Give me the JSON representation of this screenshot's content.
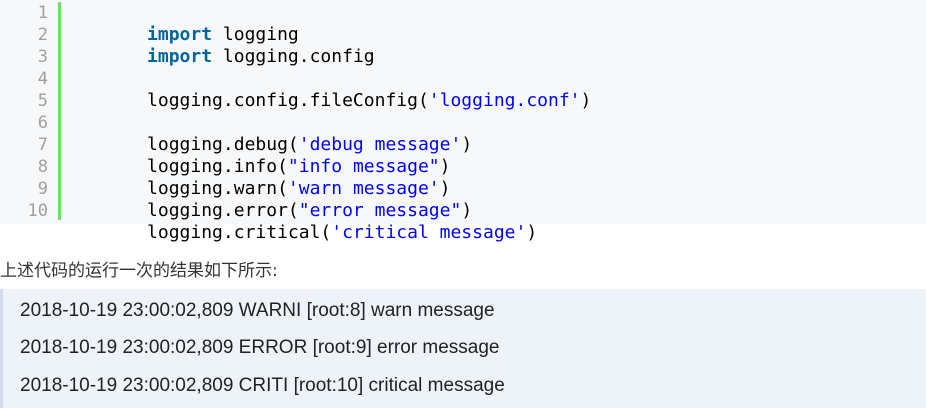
{
  "code": {
    "line_numbers": [
      "1",
      "2",
      "3",
      "4",
      "5",
      "6",
      "7",
      "8",
      "9",
      "10"
    ],
    "lines": [
      [
        {
          "t": "kw",
          "v": "import"
        },
        {
          "t": "plain",
          "v": " logging"
        }
      ],
      [
        {
          "t": "kw",
          "v": "import"
        },
        {
          "t": "plain",
          "v": " logging.config"
        }
      ],
      [],
      [
        {
          "t": "plain",
          "v": "logging.config.fileConfig("
        },
        {
          "t": "str",
          "v": "'logging.conf'"
        },
        {
          "t": "plain",
          "v": ")"
        }
      ],
      [],
      [
        {
          "t": "plain",
          "v": "logging.debug("
        },
        {
          "t": "str",
          "v": "'debug message'"
        },
        {
          "t": "plain",
          "v": ")"
        }
      ],
      [
        {
          "t": "plain",
          "v": "logging.info("
        },
        {
          "t": "str",
          "v": "\"info message\""
        },
        {
          "t": "plain",
          "v": ")"
        }
      ],
      [
        {
          "t": "plain",
          "v": "logging.warn("
        },
        {
          "t": "str",
          "v": "'warn message'"
        },
        {
          "t": "plain",
          "v": ")"
        }
      ],
      [
        {
          "t": "plain",
          "v": "logging.error("
        },
        {
          "t": "str",
          "v": "\"error message\""
        },
        {
          "t": "plain",
          "v": ")"
        }
      ],
      [
        {
          "t": "plain",
          "v": "logging.critical("
        },
        {
          "t": "str",
          "v": "'critical message'"
        },
        {
          "t": "plain",
          "v": ")"
        }
      ]
    ],
    "colors": {
      "keyword": "#006699",
      "string": "#0000ff",
      "gutter_border": "#6ce26c",
      "line_number": "#a0a0a0"
    }
  },
  "caption": "上述代码的运行一次的结果如下所示:",
  "output": {
    "lines": [
      "2018-10-19 23:00:02,809 WARNI [root:8] warn message",
      "2018-10-19 23:00:02,809 ERROR [root:9] error message",
      "2018-10-19 23:00:02,809 CRITI [root:10] critical message"
    ]
  }
}
